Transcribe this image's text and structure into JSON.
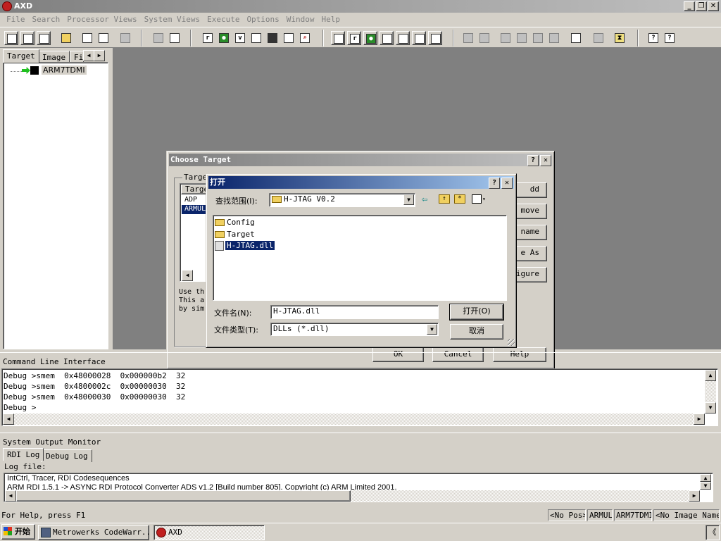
{
  "window": {
    "title": "AXD"
  },
  "menu": [
    "File",
    "Search",
    "Processor Views",
    "System Views",
    "Execute",
    "Options",
    "Window",
    "Help"
  ],
  "toolbar": {
    "icons": [
      "new-icon",
      "open-project-icon",
      "open-icon",
      "cut-icon",
      "copy-icon",
      "paste-icon",
      "find-icon",
      "find-replace-icon",
      "registers-icon",
      "memory-icon",
      "variables-icon",
      "watch-icon",
      "stack-icon",
      "disassembly-icon",
      "search-icon",
      "src-icon",
      "regs-icon",
      "mem2-icon",
      "low-level-icon",
      "console-icon",
      "local-vars-icon",
      "globals-icon",
      "go-icon",
      "run-icon",
      "step-in-icon",
      "step-icon",
      "step-out-icon",
      "run-to-cursor-icon",
      "breakpoint-icon",
      "watchpoint-icon",
      "hourglass-icon",
      "help-icon",
      "whats-this-icon"
    ],
    "letters": {
      "r": "r",
      "v": "v",
      "g": "g"
    }
  },
  "left_panel": {
    "tabs": [
      "Target",
      "Image",
      "Fi"
    ],
    "tree_item": "ARM7TDMI"
  },
  "choose_target": {
    "title": "Choose Target",
    "group_label": "Target",
    "list_header": "Targe",
    "items": [
      "ADP",
      "ARMUL"
    ],
    "info": [
      "Use th",
      "This a",
      "by sim"
    ],
    "side_buttons": [
      "dd",
      "move",
      "name",
      "e As",
      "igure"
    ],
    "buttons": {
      "ok": "OK",
      "cancel": "Cancel",
      "help": "Help"
    }
  },
  "open_dialog": {
    "title": "打开",
    "look_in_label": "查找范围(I):",
    "look_in_value": "H-JTAG V0.2",
    "files": [
      {
        "name": "Config",
        "type": "folder"
      },
      {
        "name": "Target",
        "type": "folder"
      },
      {
        "name": "H-JTAG.dll",
        "type": "dll"
      }
    ],
    "filename_label": "文件名(N):",
    "filename_value": "H-JTAG.dll",
    "filetype_label": "文件类型(T):",
    "filetype_value": "DLLs (*.dll)",
    "open_button": "打开(O)",
    "cancel_button": "取消"
  },
  "cli": {
    "title": "Command Line Interface",
    "lines": [
      "Debug >smem  0x48000028  0x000000b2  32",
      "Debug >smem  0x4800002c  0x00000030  32",
      "Debug >smem  0x48000030  0x00000030  32",
      "Debug >"
    ]
  },
  "output_monitor": {
    "title": "System Output Monitor",
    "tabs": [
      "RDI Log",
      "Debug Log"
    ],
    "log_file_label": "Log file:",
    "lines": [
      "IntCtrl, Tracer, RDI Codesequences",
      "ARM RDI 1.5.1 -> ASYNC RDI Protocol Converter ADS v1.2 [Build number 805]. Copyright (c) ARM Limited 2001."
    ]
  },
  "statusbar": {
    "help": "For Help, press F1",
    "pos": "<No Pos>",
    "target": "ARMUL",
    "processor": "ARM7TDMI",
    "image": "<No Image Name>"
  },
  "taskbar": {
    "start": "开始",
    "tasks": [
      "Metrowerks CodeWarr...",
      "AXD"
    ],
    "tray": "《"
  }
}
